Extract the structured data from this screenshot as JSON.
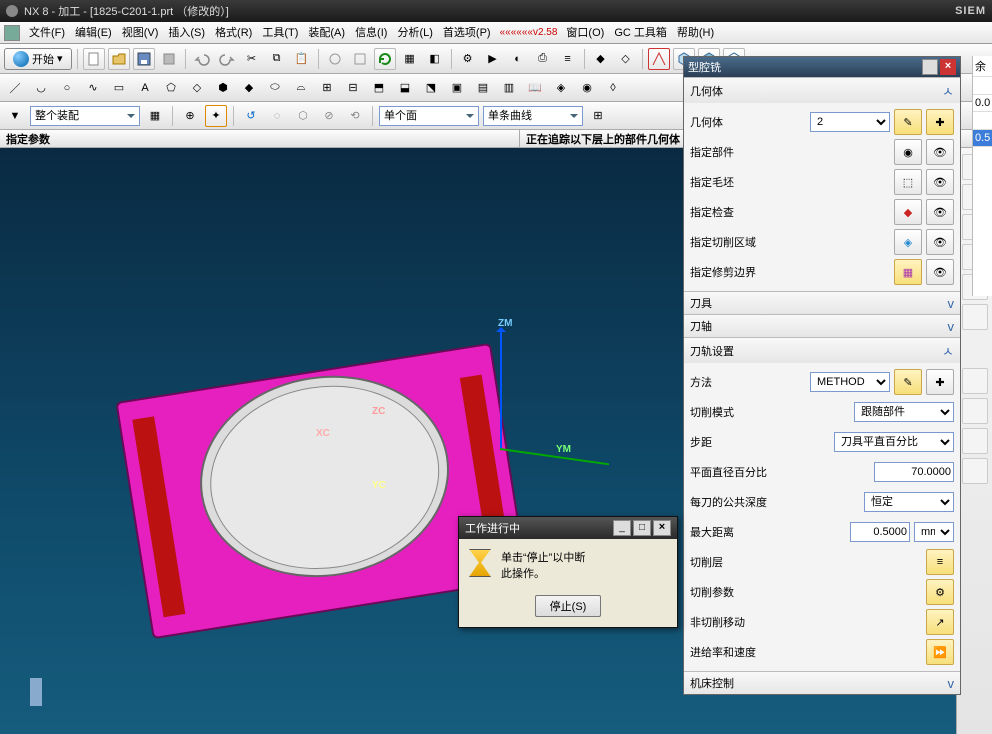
{
  "title": "NX 8 - 加工 - [1825-C201-1.prt （修改的）]",
  "branding": "SIEM",
  "menu": {
    "file": "文件(F)",
    "edit": "编辑(E)",
    "view": "视图(V)",
    "insert": "插入(S)",
    "format": "格式(R)",
    "tool": "工具(T)",
    "assy": "装配(A)",
    "info": "信息(I)",
    "analyze": "分析(L)",
    "pref": "首选项(P)",
    "window": "窗口(O)",
    "gc": "GC 工具箱",
    "help": "帮助(H)"
  },
  "version": "««««««v2.58",
  "begin": "开始",
  "combo1": "整个装配",
  "combo2": "单个面",
  "combo3": "单条曲线",
  "status": {
    "left": "指定参数",
    "right": "正在追踪以下层上的部件几何体"
  },
  "panel": {
    "title": "型腔铣",
    "geom_h": "几何体",
    "geomlabel": "几何体",
    "geomval": "2",
    "part": "指定部件",
    "blank": "指定毛坯",
    "check": "指定检查",
    "cutarea": "指定切削区域",
    "trim": "指定修剪边界",
    "tool_h": "刀具",
    "axis_h": "刀轴",
    "path_h": "刀轨设置",
    "method_l": "方法",
    "method_v": "METHOD",
    "cutpattern_l": "切削模式",
    "cutpattern_v": "跟随部件",
    "step_l": "步距",
    "step_v": "刀具平直百分比",
    "pct_l": "平面直径百分比",
    "pct_v": "70.0000",
    "depth_l": "每刀的公共深度",
    "depth_v": "恒定",
    "maxd_l": "最大距离",
    "maxd_v": "0.5000",
    "maxd_u": "mm",
    "cutlayer": "切削层",
    "cutparam": "切削参数",
    "noncut": "非切削移动",
    "feeds": "进给率和速度",
    "mct_h": "机床控制"
  },
  "sliver": {
    "a": "余",
    "b": "0.0",
    "c": "0.5"
  },
  "axes": {
    "zm": "ZM",
    "ym": "YM",
    "zc": "ZC",
    "yc": "YC",
    "xc": "XC"
  },
  "modal": {
    "title": "工作进行中",
    "line1": "单击“停止”以中断",
    "line2": "此操作。",
    "stop": "停止(S)"
  }
}
